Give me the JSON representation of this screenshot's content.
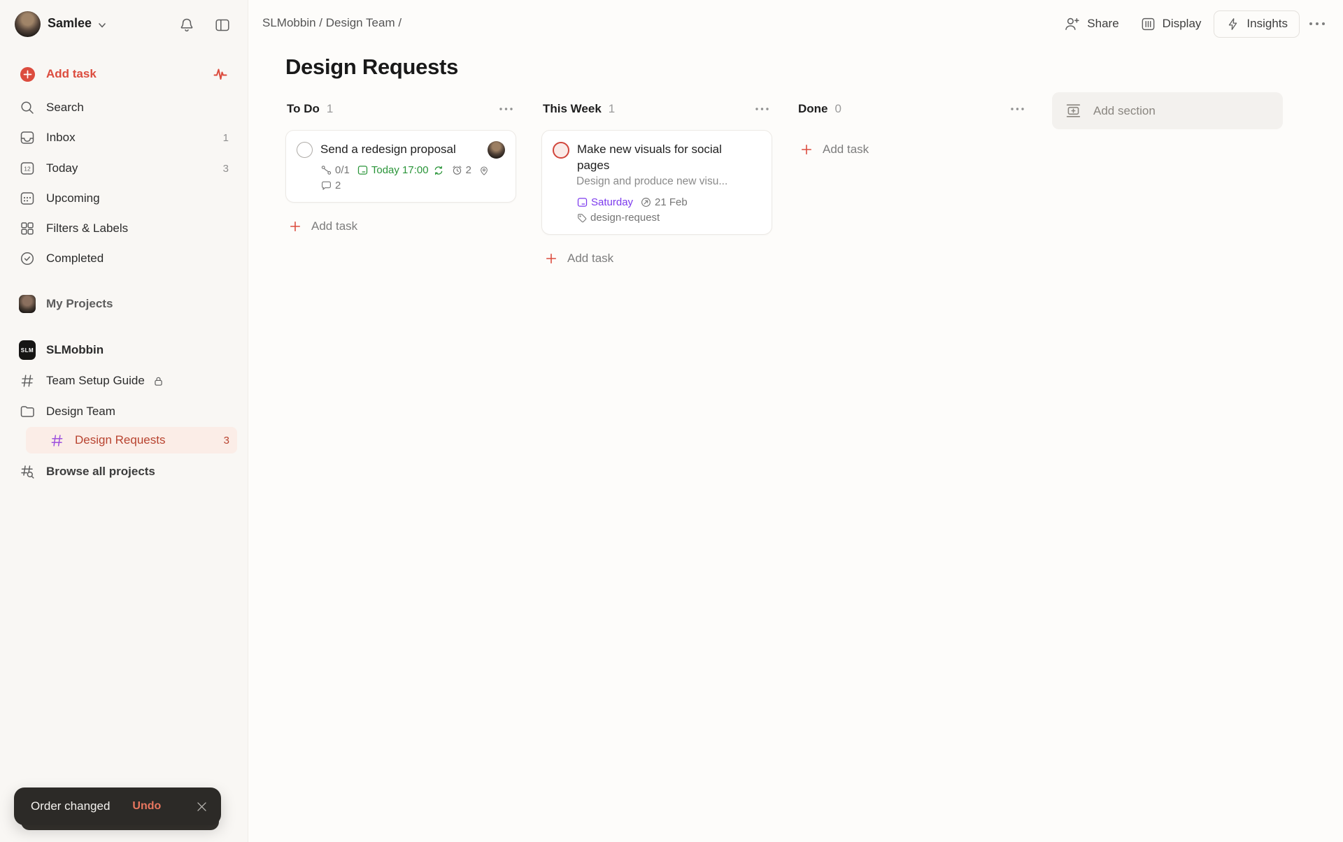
{
  "user": {
    "name": "Samlee"
  },
  "sidebar": {
    "add_task_label": "Add task",
    "today_date": "12",
    "items": [
      {
        "label": "Search",
        "count": ""
      },
      {
        "label": "Inbox",
        "count": "1"
      },
      {
        "label": "Today",
        "count": "3"
      },
      {
        "label": "Upcoming",
        "count": ""
      },
      {
        "label": "Filters & Labels",
        "count": ""
      },
      {
        "label": "Completed",
        "count": ""
      }
    ],
    "my_projects_label": "My Projects",
    "workspace": {
      "name": "SLMobbin",
      "logo_text": "SLM"
    },
    "team_project_label": "Team Setup Guide",
    "folder_label": "Design Team",
    "selected_project": {
      "label": "Design Requests",
      "count": "3"
    },
    "browse_label": "Browse all projects"
  },
  "header": {
    "breadcrumb": "SLMobbin / Design Team /",
    "share_label": "Share",
    "display_label": "Display",
    "insights_label": "Insights"
  },
  "board": {
    "title": "Design Requests",
    "add_task_label": "Add task",
    "add_section_label": "Add section",
    "columns": [
      {
        "name": "To Do",
        "count": "1"
      },
      {
        "name": "This Week",
        "count": "1"
      },
      {
        "name": "Done",
        "count": "0"
      }
    ],
    "cards": {
      "redesign": {
        "title": "Send a redesign proposal",
        "subtasks": "0/1",
        "due": "Today 17:00",
        "reminders": "2",
        "comments": "2"
      },
      "visuals": {
        "title": "Make new visuals for social pages",
        "description": "Design and produce new visu...",
        "due": "Saturday",
        "deadline": "21 Feb",
        "label": "design-request"
      }
    }
  },
  "toast": {
    "message": "Order changed",
    "action_label": "Undo"
  },
  "colors": {
    "accent": "#DC4C3E",
    "green": "#299438",
    "purple_date": "#7C3AED",
    "hash_purple": "#9D50DD",
    "selected_bg": "#FBEDE7",
    "selected_text": "#B8432F",
    "toast_bg": "#2C2A27",
    "toast_action": "#E8765F"
  }
}
